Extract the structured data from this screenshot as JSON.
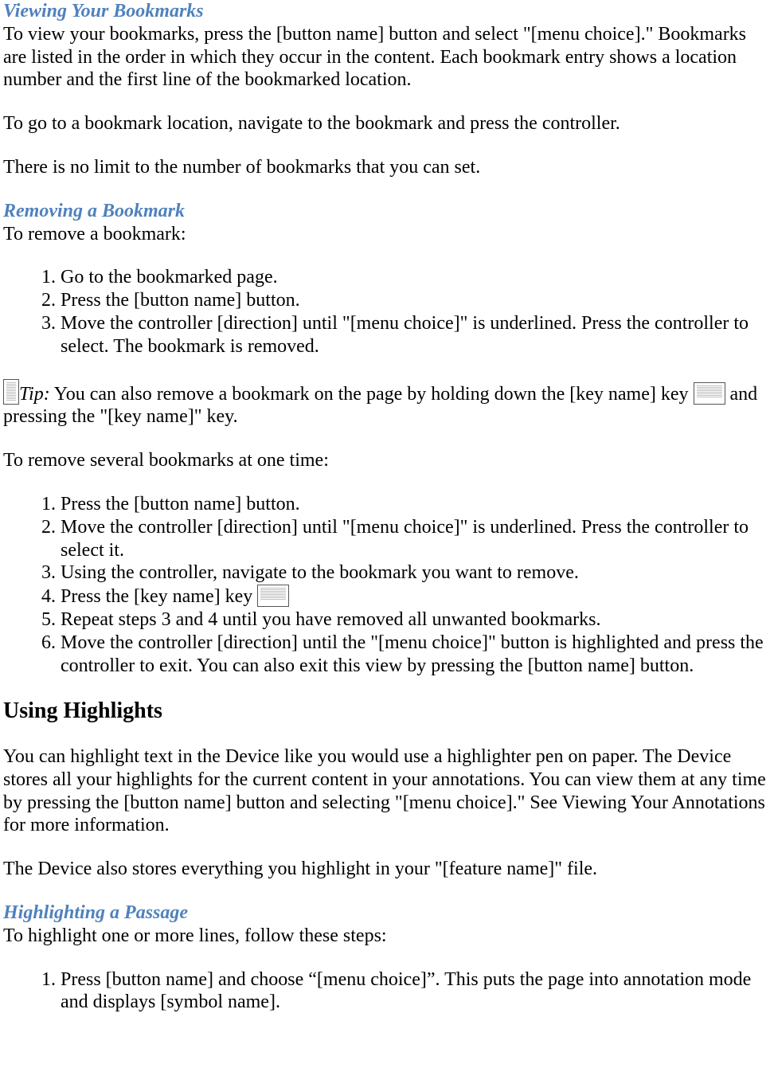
{
  "sections": {
    "viewing_bookmarks": {
      "heading": "Viewing Your Bookmarks",
      "p1": "To view your bookmarks, press the [button name] button and select \"[menu choice].\" Bookmarks are listed in the order in which they occur in the content. Each bookmark entry shows a location number and the first line of the bookmarked location.",
      "p2": "To go to a bookmark location, navigate to the bookmark and press the controller.",
      "p3": "There is no limit to the number of bookmarks that you can set."
    },
    "removing_bookmark": {
      "heading": "Removing a Bookmark",
      "intro": "To remove a bookmark:",
      "steps": [
        "Go to the bookmarked page.",
        "Press the [button name] button.",
        "Move the controller [direction] until \"[menu choice]\" is underlined. Press the controller to select. The bookmark is removed."
      ],
      "tip_label": "Tip:",
      "tip_text_a": " You can also remove a bookmark on the page by holding down the [key name] key ",
      "tip_text_b": " and pressing the \"[key name]\" key.",
      "several_intro": "To remove several bookmarks at one time:",
      "several_steps": {
        "s1": "Press the [button name] button.",
        "s2": "Move the controller [direction] until \"[menu choice]\" is underlined. Press the controller to select it.",
        "s3": "Using the controller, navigate to the bookmark you want to remove.",
        "s4": "Press the [key name] key ",
        "s5": "Repeat steps 3 and 4 until you have removed all unwanted bookmarks.",
        "s6": "Move the controller [direction] until the \"[menu choice]\" button is highlighted and press the controller to exit. You can also exit this view by pressing the [button name] button."
      }
    },
    "using_highlights": {
      "heading": "Using Highlights",
      "p1": "You can highlight text in the Device like you would use a highlighter pen on paper. The Device stores all your highlights for the current content in your annotations. You can view them at any time by pressing the [button name] button and selecting \"[menu choice].\" See Viewing Your Annotations for more information.",
      "p2": "The Device also stores everything you highlight in your \"[feature name]\" file."
    },
    "highlighting_passage": {
      "heading": "Highlighting a Passage",
      "intro": "To highlight one or more lines, follow these steps:",
      "steps": [
        "Press [button name] and choose “[menu choice]”. This puts the page into annotation mode and displays [symbol name]."
      ]
    }
  }
}
